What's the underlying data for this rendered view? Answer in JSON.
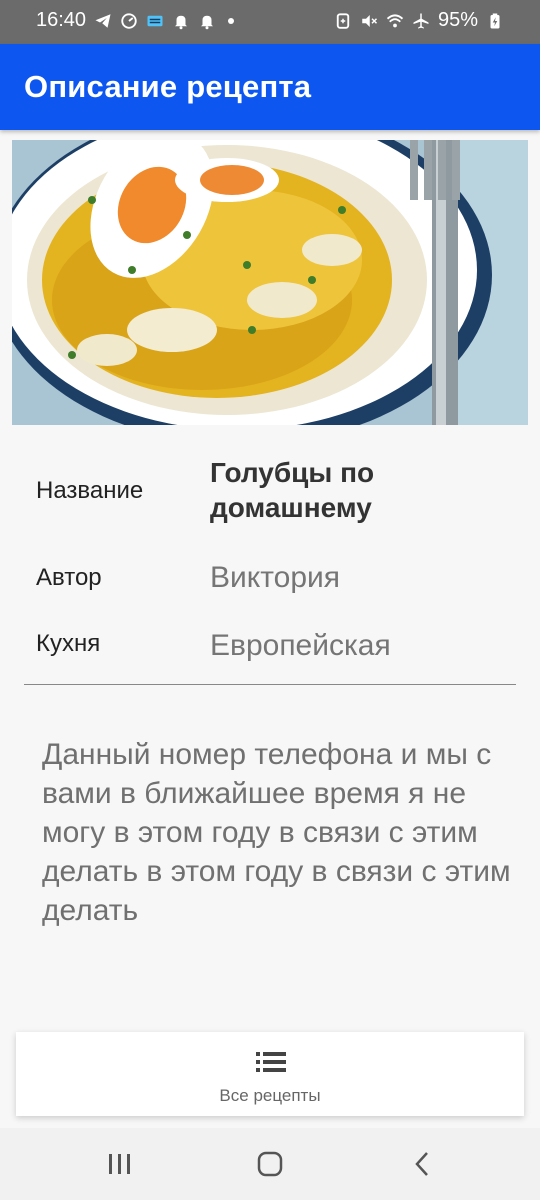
{
  "status_bar": {
    "time": "16:40",
    "battery": "95%",
    "left_icons": [
      "telegram-icon",
      "speedometer-icon",
      "keyboard-icon",
      "notification-icon",
      "notification-icon"
    ],
    "right_icons": [
      "battery-saver-icon",
      "mute-icon",
      "wifi-icon",
      "airplane-icon",
      "battery-icon"
    ]
  },
  "app_bar": {
    "title": "Описание рецепта"
  },
  "recipe": {
    "image_alt_icon": "food-photo",
    "name_label": "Название",
    "name_value": "Голубцы по домашнему",
    "author_label": "Автор",
    "author_value": "Виктория",
    "cuisine_label": "Кухня",
    "cuisine_value": "Европейская",
    "description": "Данный номер телефона и мы с вами в ближайшее время я не могу в этом году в связи с этим делать в этом году в связи с этим делать"
  },
  "bottom_nav": {
    "icon": "list-icon",
    "label": "Все рецепты"
  },
  "system_nav": {
    "icons": [
      "recent-apps-icon",
      "home-icon",
      "back-icon"
    ]
  },
  "colors": {
    "app_bar": "#0d57f0",
    "status_bar": "#6b6b6b",
    "background": "#f7f7f7"
  }
}
